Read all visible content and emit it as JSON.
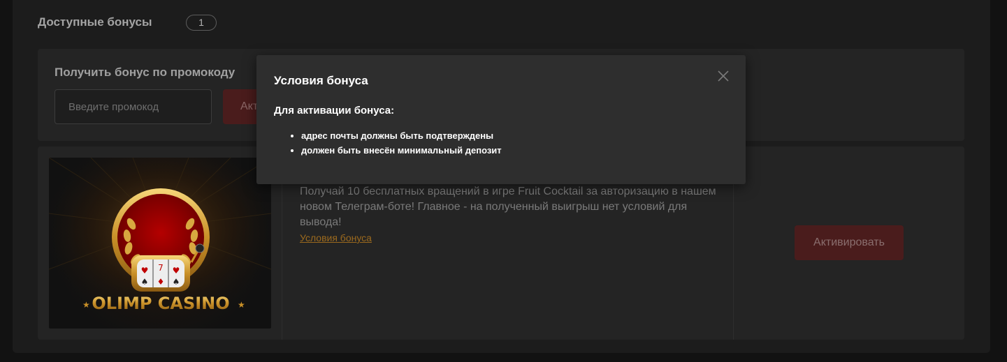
{
  "bonuses_section": {
    "title": "Доступные бонусы",
    "count": "1"
  },
  "promo": {
    "title": "Получить бонус по промокоду",
    "input_placeholder": "Введите промокод",
    "activate_label": "Акт"
  },
  "bonus_card": {
    "image_caption": "OLIMP CASINO",
    "description": "Получай 10 бесплатных вращений в игре Fruit Cocktail за авторизацию в нашем новом Телеграм-боте! Главное - на полученный выигрыш нет условий для вывода!",
    "terms_link": "Условия бонуса",
    "activate_label": "Активировать"
  },
  "modal": {
    "title": "Условия бонуса",
    "subtitle": "Для активации бонуса:",
    "conditions": [
      "адрес почты должны быть подтверждены",
      "должен быть внесён минимальный депозит"
    ],
    "close_icon": "close-icon"
  },
  "colors": {
    "background": "#121212",
    "panel": "#1c1c1c",
    "card": "#242424",
    "modal": "#2e2e2e",
    "button_dark_red": "#4a1c1c",
    "link_orange": "#9c6a1e"
  }
}
